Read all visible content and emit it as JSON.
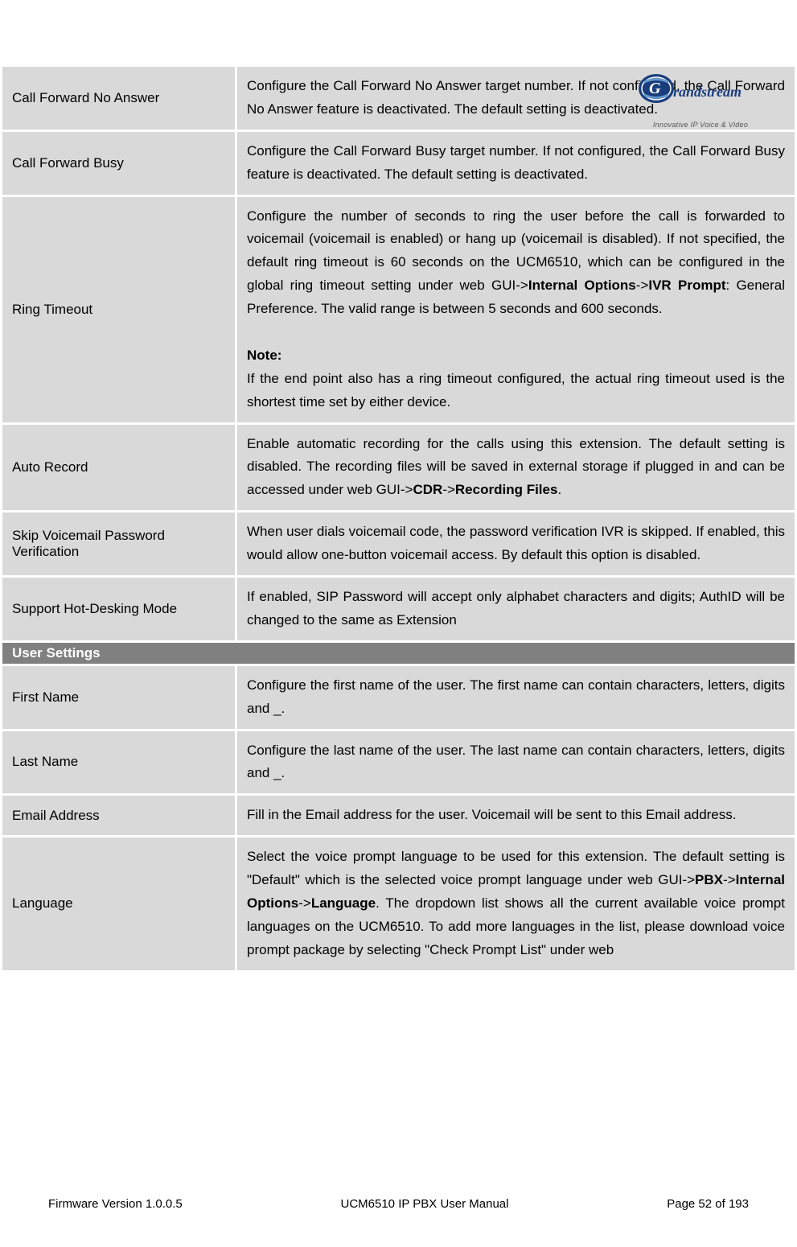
{
  "logo": {
    "brand": "Grandstream",
    "tagline": "Innovative IP Voice & Video"
  },
  "rows": [
    {
      "label": "Call Forward No Answer",
      "desc_html": "Configure the Call Forward No Answer target number. If not configured, the Call Forward No Answer feature is deactivated. The default setting is deactivated."
    },
    {
      "label": "Call Forward Busy",
      "desc_html": "Configure the Call Forward Busy target number. If not configured, the Call Forward Busy feature is deactivated. The default setting is deactivated."
    },
    {
      "label": "Ring Timeout",
      "desc_html": "Configure the number of seconds to ring the user before the call is forwarded to voicemail (voicemail is enabled) or hang up (voicemail is disabled). If not specified, the default ring timeout is 60 seconds on the UCM6510, which can be configured in the global ring timeout setting under web GUI-><b>Internal Options</b>-><b>IVR Prompt</b>: General Preference. The valid range is between 5 seconds and 600 seconds.<br><br><b>Note:</b><br>If the end point also has a ring timeout configured, the actual ring timeout used is the shortest time set by either device."
    },
    {
      "label": "Auto Record",
      "desc_html": "Enable automatic recording for the calls using this extension. The default setting is disabled. The recording files will be saved in external storage if plugged in and can be accessed under web GUI-><b>CDR</b>-><b>Recording Files</b>."
    },
    {
      "label": "Skip Voicemail Password Verification",
      "desc_html": "When user dials voicemail code, the password verification IVR is skipped. If enabled, this would allow one-button voicemail access. By default this option is disabled."
    },
    {
      "label": "Support Hot-Desking Mode",
      "desc_html": "If enabled, SIP Password will accept only alphabet characters and digits; AuthID will be changed to the same as Extension"
    }
  ],
  "section_header": "User Settings",
  "rows2": [
    {
      "label": "First Name",
      "desc_html": "Configure the first name of the user. The first name can contain characters, letters, digits and _."
    },
    {
      "label": "Last Name",
      "desc_html": "Configure the last name of the user. The last name can contain characters, letters, digits and _."
    },
    {
      "label": "Email Address",
      "desc_html": "Fill in the Email address for the user. Voicemail will be sent to this Email address."
    },
    {
      "label": "Language",
      "desc_html": "Select the voice prompt language to be used for this extension. The default setting is \"Default\" which is the selected voice prompt language under web GUI-><b>PBX</b>-><b>Internal Options</b>-><b>Language</b>. The dropdown list shows all the current available voice prompt languages on the UCM6510. To add more languages in the list, please download voice prompt package by selecting \"Check Prompt List\" under web"
    }
  ],
  "footer": {
    "left": "Firmware Version 1.0.0.5",
    "center": "UCM6510 IP PBX User Manual",
    "right": "Page 52 of 193"
  }
}
